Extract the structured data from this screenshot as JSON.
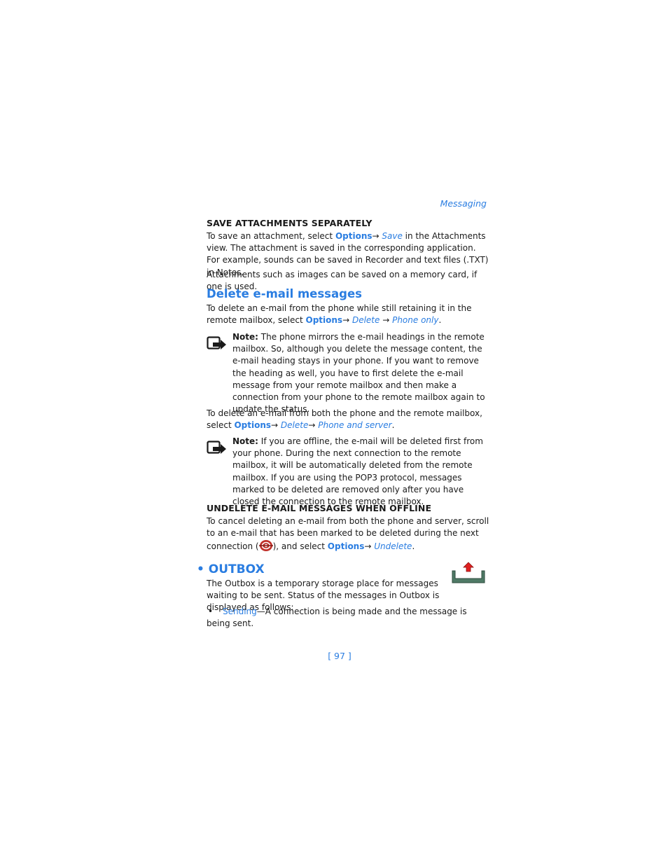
{
  "running_head": "Messaging",
  "section_save": {
    "heading": "SAVE ATTACHMENTS SEPARATELY",
    "p1_pre": "To save an attachment, select ",
    "p1_opt": "Options",
    "p1_arrow": "→ ",
    "p1_ital": "Save",
    "p1_post": " in the Attachments view. The attachment is saved in the corresponding application. For example, sounds can be saved in Recorder and text files (.TXT) in Notes.",
    "p2": "Attachments such as images can be saved on a memory card, if one is used."
  },
  "section_delete": {
    "heading": "Delete e-mail messages",
    "p1_pre": "To delete an e-mail from the phone while still retaining it in the remote mailbox, select ",
    "p1_opt": "Options",
    "p1_arrow1": "→ ",
    "p1_ital1": "Delete",
    "p1_arrow2": " → ",
    "p1_ital2": "Phone only",
    "p1_end": ".",
    "note1_label": "Note:",
    "note1_text": " The phone mirrors the e-mail headings in the remote mailbox. So, although you delete the message content, the e-mail heading stays in your phone. If you want to remove the heading as well, you have to first delete the e-mail message from your remote mailbox and then make a connection from your phone to the remote mailbox again to update the status.",
    "p2_pre": "To delete an e-mail from both the phone and the remote mailbox, select ",
    "p2_opt": "Options",
    "p2_arrow1": "→ ",
    "p2_ital1": "Delete",
    "p2_arrow2": "→ ",
    "p2_ital2": "Phone and server",
    "p2_end": ".",
    "note2_label": "Note:",
    "note2_text": " If you are offline, the e-mail will be deleted first from your phone. During the next connection to the remote mailbox, it will be automatically deleted from the remote mailbox. If you are using the POP3 protocol, messages marked to be deleted are removed only after you have closed the connection to the remote mailbox."
  },
  "section_undelete": {
    "heading": "UNDELETE E-MAIL MESSAGES WHEN OFFLINE",
    "p1_pre": "To cancel deleting an e-mail from both the phone and server, scroll to an e-mail that has been marked to be deleted during the next connection (",
    "p1_mid": "), and select ",
    "p1_opt": "Options",
    "p1_arrow": "→ ",
    "p1_ital": "Undelete",
    "p1_end": ".",
    "icon": "deleted-email-icon"
  },
  "section_outbox": {
    "bullet": "•",
    "heading": "OUTBOX",
    "icon": "outbox-icon",
    "p1": "The Outbox is a temporary storage place for messages waiting to be sent. Status of the messages in Outbox is displayed as follows:",
    "list": [
      {
        "bullet": "•",
        "term": "Sending",
        "desc": "—A connection is being made and the message is being sent."
      }
    ]
  },
  "page_number": "[ 97 ]",
  "colors": {
    "accent": "#2a7de1",
    "text": "#1a1a1a"
  }
}
